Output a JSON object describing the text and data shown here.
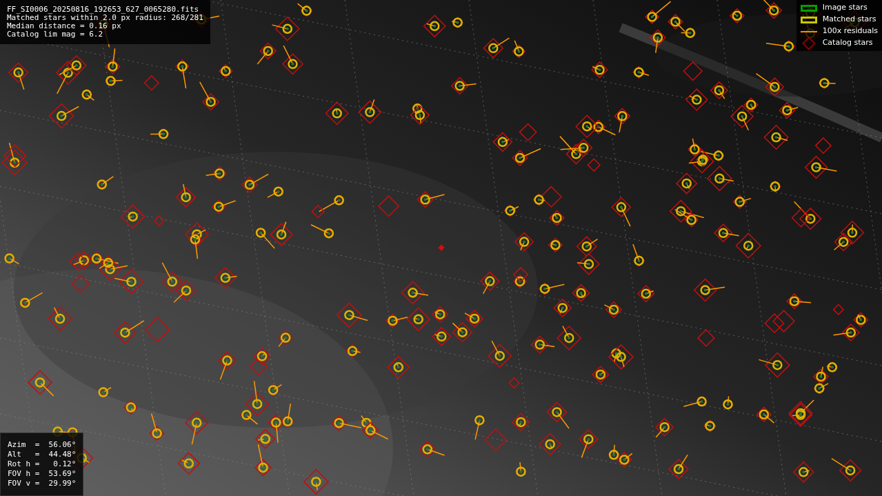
{
  "header": {
    "lines": [
      "FF_SI0006_20250816_192653_627_0065280.fits",
      "Matched stars within 2.0 px radius: 268/281",
      "Median distance = 0.16 px",
      "Catalog lim mag = 6.2"
    ]
  },
  "legend": [
    {
      "kind": "box",
      "color": "#00a000",
      "label": "Image stars"
    },
    {
      "kind": "box",
      "color": "#c8c800",
      "label": "Matched stars"
    },
    {
      "kind": "line",
      "color": "#ff8c00",
      "label": "100x residuals"
    },
    {
      "kind": "diamond",
      "color": "#8b0000",
      "label": "Catalog stars"
    }
  ],
  "pointing": {
    "lines": [
      "Azim  =  56.06°",
      "Alt   =  44.48°",
      "Rot h =   0.12°",
      "FOV h =  53.69°",
      "FOV v =  29.99°"
    ]
  }
}
